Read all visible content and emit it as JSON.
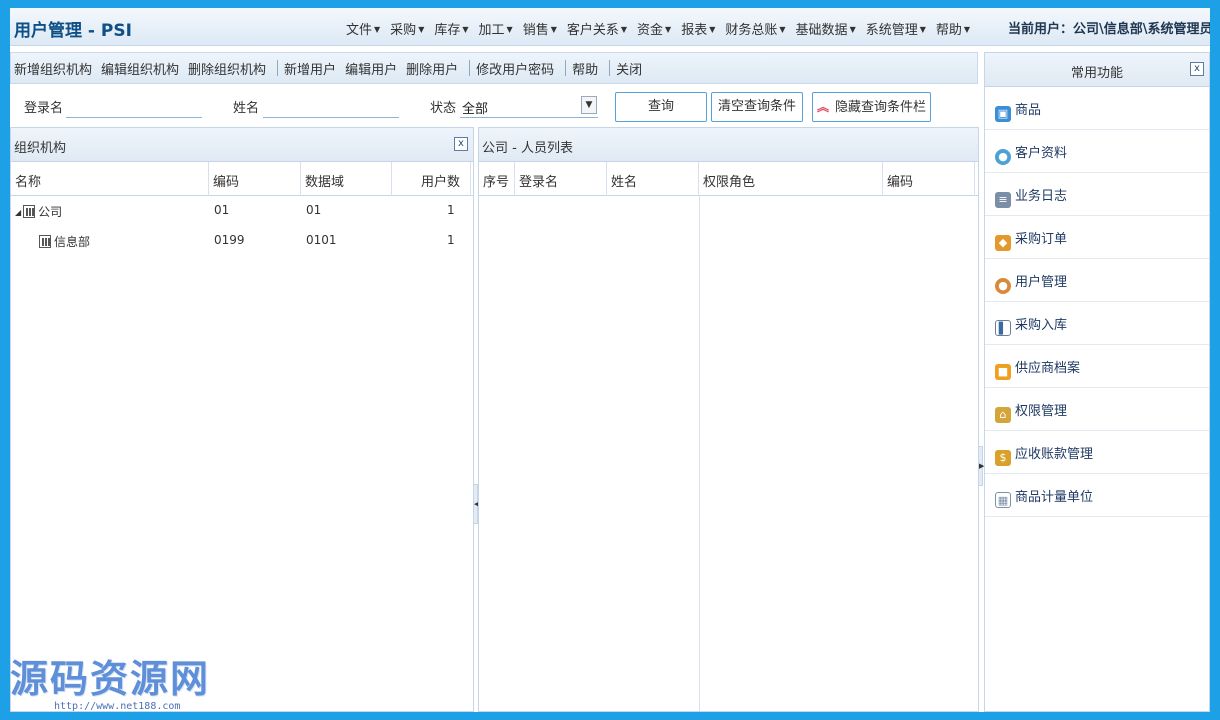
{
  "header": {
    "title": "用户管理 - PSI",
    "menu": [
      "文件",
      "采购",
      "库存",
      "加工",
      "销售",
      "客户关系",
      "资金",
      "报表",
      "财务总账",
      "基础数据",
      "系统管理",
      "帮助"
    ],
    "current_user": "当前用户：公司\\信息部\\系统管理员"
  },
  "toolbar": {
    "add_org": "新增组织机构",
    "edit_org": "编辑组织机构",
    "delete_org": "删除组织机构",
    "add_user": "新增用户",
    "edit_user": "编辑用户",
    "delete_user": "删除用户",
    "change_password": "修改用户密码",
    "help": "帮助",
    "close": "关闭"
  },
  "query": {
    "login_label": "登录名",
    "login_value": "",
    "name_label": "姓名",
    "name_value": "",
    "status_label": "状态",
    "status_value": "全部",
    "search_btn": "查询",
    "clear_btn": "清空查询条件",
    "hide_btn": "隐藏查询条件栏"
  },
  "org_panel": {
    "title": "组织机构",
    "columns": [
      "名称",
      "编码",
      "数据域",
      "用户数"
    ],
    "rows": [
      {
        "name": "公司",
        "code": "01",
        "domain": "01",
        "users": "1"
      },
      {
        "name": "信息部",
        "code": "0199",
        "domain": "0101",
        "users": "1"
      }
    ]
  },
  "user_panel": {
    "title": "公司 - 人员列表",
    "columns": [
      "序号",
      "登录名",
      "姓名",
      "权限角色",
      "编码"
    ]
  },
  "side": {
    "title": "常用功能",
    "items": [
      {
        "label": "商品",
        "icon": "product-icon",
        "color": "#3b8fd6"
      },
      {
        "label": "客户资料",
        "icon": "customer-icon",
        "color": "#4aa1d8"
      },
      {
        "label": "业务日志",
        "icon": "log-icon",
        "color": "#7a8ea6"
      },
      {
        "label": "采购订单",
        "icon": "purchase-order-icon",
        "color": "#e49a2b"
      },
      {
        "label": "用户管理",
        "icon": "user-admin-icon",
        "color": "#d88a3a"
      },
      {
        "label": "采购入库",
        "icon": "purchase-in-icon",
        "color": "#6b7f99"
      },
      {
        "label": "供应商档案",
        "icon": "supplier-icon",
        "color": "#f0a020"
      },
      {
        "label": "权限管理",
        "icon": "lock-icon",
        "color": "#d4a53a"
      },
      {
        "label": "应收账款管理",
        "icon": "receivable-icon",
        "color": "#d9a02a"
      },
      {
        "label": "商品计量单位",
        "icon": "unit-icon",
        "color": "#7d90aa"
      }
    ]
  },
  "watermark": {
    "text": "源码资源网",
    "url": "http://www.net188.com"
  }
}
